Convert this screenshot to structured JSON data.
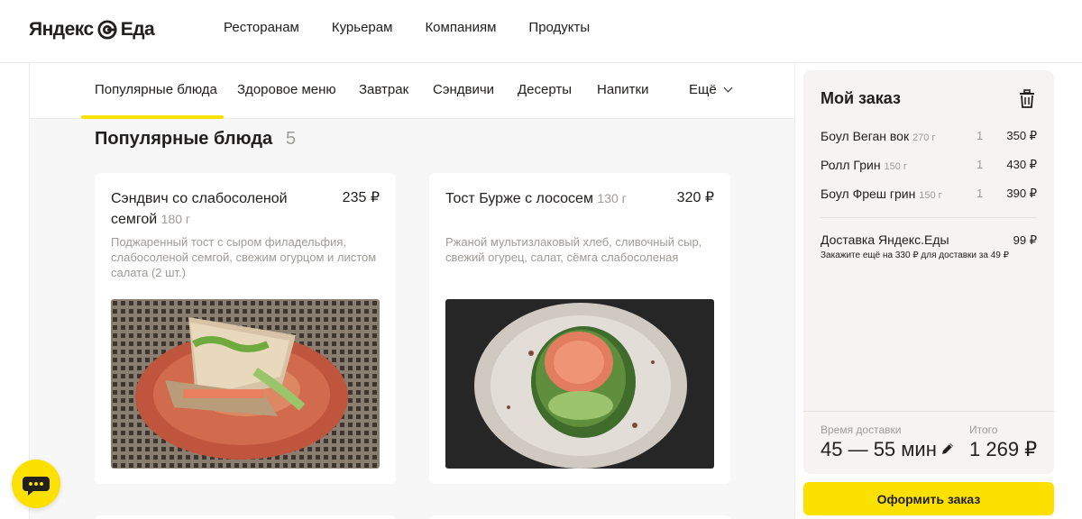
{
  "header": {
    "logo_left": "Яндекс",
    "logo_right": "Еда",
    "nav": [
      "Ресторанам",
      "Курьерам",
      "Компаниям",
      "Продукты"
    ]
  },
  "tabs": [
    {
      "label": "Популярные блюда",
      "active": true
    },
    {
      "label": "Здоровое меню"
    },
    {
      "label": "Завтрак"
    },
    {
      "label": "Сэндвичи"
    },
    {
      "label": "Десерты"
    },
    {
      "label": "Напитки"
    },
    {
      "label": "Ещё"
    }
  ],
  "section": {
    "title": "Популярные блюда",
    "count": "5"
  },
  "products": [
    {
      "name": "Сэндвич со слабосоленой семгой",
      "weight": "180 г",
      "price": "235 ₽",
      "description": "Поджаренный тост с сыром филадельфия, слабосоленой семгой, свежим огурцом и листом салата (2 шт.)"
    },
    {
      "name": "Тост Бурже с лососем",
      "weight": "130 г",
      "price": "320 ₽",
      "description": "Ржаной мультизлаковый хлеб, сливочный сыр, свежий огурец, салат, сёмга слабосоленая"
    }
  ],
  "cart": {
    "title": "Мой заказ",
    "items": [
      {
        "name": "Боул Веган вок",
        "weight": "270 г",
        "qty": "1",
        "price": "350 ₽"
      },
      {
        "name": "Ролл Грин",
        "weight": "150 г",
        "qty": "1",
        "price": "430 ₽"
      },
      {
        "name": "Боул Фреш грин",
        "weight": "150 г",
        "qty": "1",
        "price": "390 ₽"
      }
    ],
    "delivery": {
      "name": "Доставка Яндекс.Еды",
      "price": "99 ₽",
      "hint": "Закажите ещё на 330 ₽ для доставки за 49 ₽"
    },
    "time_label": "Время доставки",
    "time_value": "45 — 55 мин",
    "total_label": "Итого",
    "total_value": "1 269 ₽",
    "checkout_label": "Оформить заказ"
  },
  "colors": {
    "accent": "#fce000",
    "text": "#21201f",
    "muted": "#9e9b98"
  }
}
